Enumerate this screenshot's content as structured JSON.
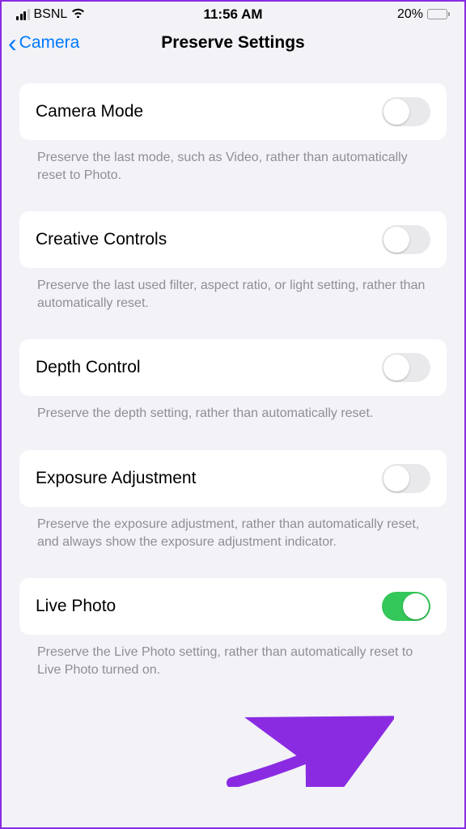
{
  "status": {
    "carrier": "BSNL",
    "time": "11:56 AM",
    "battery_pct": "20%"
  },
  "nav": {
    "back_label": "Camera",
    "title": "Preserve Settings"
  },
  "settings": [
    {
      "label": "Camera Mode",
      "desc": "Preserve the last mode, such as Video, rather than automatically reset to Photo.",
      "on": false
    },
    {
      "label": "Creative Controls",
      "desc": "Preserve the last used filter, aspect ratio, or light setting, rather than automatically reset.",
      "on": false
    },
    {
      "label": "Depth Control",
      "desc": "Preserve the depth setting, rather than automatically reset.",
      "on": false
    },
    {
      "label": "Exposure Adjustment",
      "desc": "Preserve the exposure adjustment, rather than automatically reset, and always show the exposure adjustment indicator.",
      "on": false
    },
    {
      "label": "Live Photo",
      "desc": "Preserve the Live Photo setting, rather than automatically reset to Live Photo turned on.",
      "on": true
    }
  ]
}
